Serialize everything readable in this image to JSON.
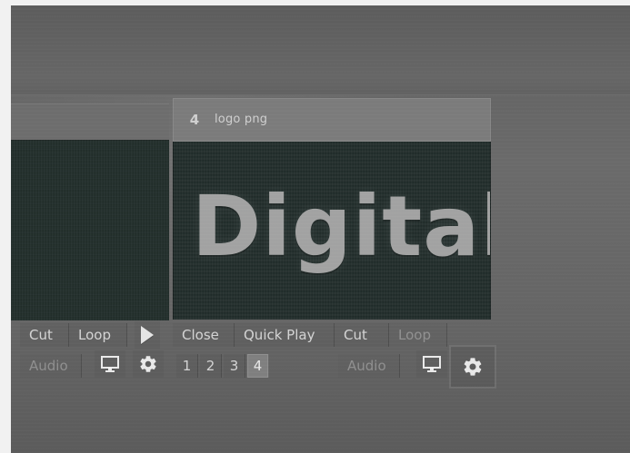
{
  "left_controls": {
    "buttons": {
      "cut": "Cut",
      "loop": "Loop",
      "audio": "Audio"
    }
  },
  "main_panel": {
    "header": {
      "number": "4",
      "filename": "logo png"
    },
    "preview_text": "Digital",
    "buttons_row1": {
      "close": "Close",
      "quick_play": "Quick Play",
      "cut": "Cut",
      "loop": "Loop"
    },
    "buttons_row2": {
      "numbers": [
        "1",
        "2",
        "3",
        "4"
      ],
      "selected_number": "4",
      "audio": "Audio"
    }
  },
  "icons": {
    "monitor": "monitor-icon",
    "gear": "gear-icon",
    "play": "play-icon"
  },
  "colors": {
    "text": "#e8e8e8",
    "selected_bg": "#7f7f7f",
    "panel_bg": "#1f2a28"
  }
}
